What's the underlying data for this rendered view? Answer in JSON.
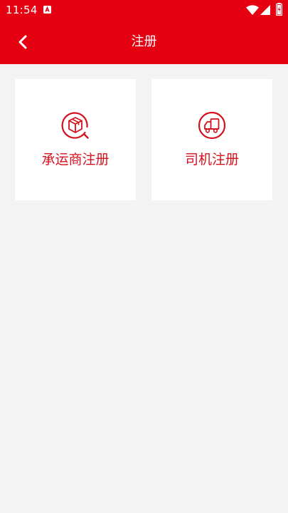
{
  "status_bar": {
    "time": "11:54",
    "app_icon": "a-letter-icon",
    "icons": [
      "wifi-icon",
      "signal-icon",
      "battery-icon"
    ]
  },
  "nav": {
    "title": "注册",
    "back_icon": "chevron-left-icon"
  },
  "cards": [
    {
      "label": "承运商注册",
      "icon": "package-search-icon"
    },
    {
      "label": "司机注册",
      "icon": "truck-icon"
    }
  ],
  "colors": {
    "primary": "#e50012",
    "label": "#d4111e",
    "background": "#f3f3f3",
    "card": "#ffffff"
  }
}
